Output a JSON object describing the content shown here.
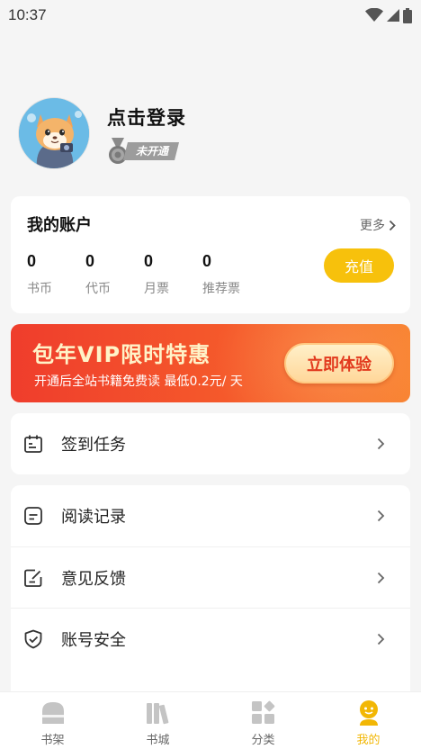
{
  "status_bar": {
    "time": "10:37"
  },
  "profile": {
    "login_prompt": "点击登录",
    "vip_status": "未开通"
  },
  "account": {
    "title": "我的账户",
    "more_label": "更多",
    "stats": [
      {
        "value": "0",
        "label": "书币"
      },
      {
        "value": "0",
        "label": "代币"
      },
      {
        "value": "0",
        "label": "月票"
      },
      {
        "value": "0",
        "label": "推荐票"
      }
    ],
    "recharge_label": "充值"
  },
  "vip_banner": {
    "title": "包年VIP限时特惠",
    "subtitle": "开通后全站书籍免费读 最低0.2元/ 天",
    "button_label": "立即体验"
  },
  "menu": {
    "tasks": {
      "label": "签到任务",
      "icon": "calendar-icon"
    },
    "items": [
      {
        "label": "阅读记录",
        "icon": "reading-record-icon"
      },
      {
        "label": "意见反馈",
        "icon": "feedback-icon"
      },
      {
        "label": "账号安全",
        "icon": "shield-icon"
      }
    ]
  },
  "tab_bar": {
    "tabs": [
      {
        "label": "书架",
        "icon": "bookshelf-icon",
        "active": false
      },
      {
        "label": "书城",
        "icon": "bookstore-icon",
        "active": false
      },
      {
        "label": "分类",
        "icon": "category-icon",
        "active": false
      },
      {
        "label": "我的",
        "icon": "profile-icon",
        "active": true
      }
    ]
  },
  "colors": {
    "accent": "#f7c10c",
    "active_tab": "#f2b705",
    "banner_start": "#ef3d2c",
    "banner_end": "#f8812e"
  }
}
